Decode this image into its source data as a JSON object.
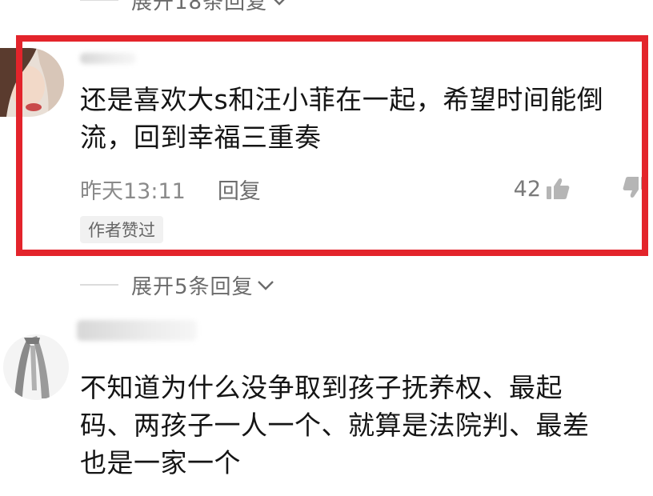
{
  "replies_top": {
    "label": "展开18条回复"
  },
  "comment1": {
    "text_line1": "还是喜欢大s和汪小菲在一起，希望时间能倒",
    "text_line2": "流，回到幸福三重奏",
    "time": "昨天13:11",
    "reply_label": "回复",
    "like_count": "42",
    "author_badge": "作者赞过"
  },
  "replies_mid": {
    "label": "展开5条回复"
  },
  "comment2": {
    "text_line1": "不知道为什么没争取到孩子抚养权、最起",
    "text_line2": "码、两孩子一人一个、就算是法院判、最差",
    "text_line3": "也是一家一个"
  },
  "colors": {
    "highlight_border": "#e3242b",
    "secondary_text": "#8a8a8a",
    "primary_text": "#151515"
  },
  "icons": {
    "like": "thumb-up-icon",
    "dislike": "thumb-down-icon",
    "expand": "chevron-down-icon"
  }
}
